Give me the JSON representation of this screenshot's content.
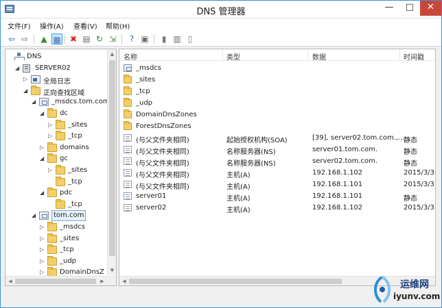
{
  "window": {
    "title": "DNS 管理器",
    "min": "—",
    "max": "□",
    "close": "✕"
  },
  "menu": [
    {
      "label": "文件(F)"
    },
    {
      "label": "操作(A)"
    },
    {
      "label": "查看(V)"
    },
    {
      "label": "帮助(H)"
    }
  ],
  "toolbar": [
    {
      "icon": "back-arrow-icon",
      "glyph": "⇦",
      "color": "#1a62b5"
    },
    {
      "icon": "forward-arrow-icon",
      "glyph": "⇨",
      "color": "#6f6f6f"
    },
    {
      "icon": "up-folder-icon",
      "glyph": "▲",
      "color": "#3b8e2f"
    },
    {
      "icon": "show-hide-tree-icon",
      "glyph": "▦",
      "color": "#4570a8"
    },
    {
      "icon": "delete-icon",
      "glyph": "✖",
      "color": "#d1281f"
    },
    {
      "icon": "properties-icon",
      "glyph": "▤",
      "color": "#6a6a6a"
    },
    {
      "icon": "refresh-icon",
      "glyph": "↻",
      "color": "#2f8a3a"
    },
    {
      "icon": "export-icon",
      "glyph": "⇲",
      "color": "#3b8e2f"
    },
    {
      "icon": "help-icon",
      "glyph": "?",
      "color": "#2f5fb0"
    },
    {
      "icon": "action-pane-icon",
      "glyph": "▣",
      "color": "#6a6a6a"
    },
    {
      "icon": "server-icon",
      "glyph": "▮",
      "color": "#7a7a7a"
    },
    {
      "icon": "list-icon",
      "glyph": "▥",
      "color": "#6a6a6a"
    },
    {
      "icon": "detail-icon",
      "glyph": "▯",
      "color": "#7a7a7a"
    }
  ],
  "tree": [
    {
      "label": "DNS",
      "icon": "dns-root",
      "arrow": "",
      "depth": 0
    },
    {
      "label": "SERVER02",
      "icon": "server",
      "arrow": "◢",
      "depth": 1
    },
    {
      "label": "全局日志",
      "icon": "log",
      "arrow": "▷",
      "depth": 2
    },
    {
      "label": "正向查找区域",
      "icon": "folder",
      "arrow": "◢",
      "depth": 2
    },
    {
      "label": "_msdcs.tom.com",
      "icon": "zone",
      "arrow": "◢",
      "depth": 3
    },
    {
      "label": "dc",
      "icon": "folder",
      "arrow": "◢",
      "depth": 4
    },
    {
      "label": "_sites",
      "icon": "folder",
      "arrow": "▷",
      "depth": 5
    },
    {
      "label": "_tcp",
      "icon": "folder",
      "arrow": "▷",
      "depth": 5
    },
    {
      "label": "domains",
      "icon": "folder",
      "arrow": "▷",
      "depth": 4
    },
    {
      "label": "gc",
      "icon": "folder",
      "arrow": "◢",
      "depth": 4
    },
    {
      "label": "_sites",
      "icon": "folder",
      "arrow": "▷",
      "depth": 5
    },
    {
      "label": "_tcp",
      "icon": "folder",
      "arrow": "",
      "depth": 5
    },
    {
      "label": "pdc",
      "icon": "folder",
      "arrow": "◢",
      "depth": 4
    },
    {
      "label": "_tcp",
      "icon": "folder",
      "arrow": "",
      "depth": 5
    },
    {
      "label": "tom.com",
      "icon": "zone",
      "arrow": "◢",
      "depth": 3,
      "selected": true
    },
    {
      "label": "_msdcs",
      "icon": "folder",
      "arrow": "▷",
      "depth": 4
    },
    {
      "label": "_sites",
      "icon": "folder",
      "arrow": "▷",
      "depth": 4
    },
    {
      "label": "_tcp",
      "icon": "folder",
      "arrow": "▷",
      "depth": 4
    },
    {
      "label": "_udp",
      "icon": "folder",
      "arrow": "▷",
      "depth": 4
    },
    {
      "label": "DomainDnsZ",
      "icon": "folder",
      "arrow": "▷",
      "depth": 4
    }
  ],
  "list": {
    "columns": [
      "名称",
      "类型",
      "数据",
      "时间戳"
    ],
    "rows": [
      {
        "icon": "zone",
        "name": "_msdcs",
        "type": "",
        "data": "",
        "time": ""
      },
      {
        "icon": "folder",
        "name": "_sites",
        "type": "",
        "data": "",
        "time": ""
      },
      {
        "icon": "folder",
        "name": "_tcp",
        "type": "",
        "data": "",
        "time": ""
      },
      {
        "icon": "folder",
        "name": "_udp",
        "type": "",
        "data": "",
        "time": ""
      },
      {
        "icon": "folder",
        "name": "DomainDnsZones",
        "type": "",
        "data": "",
        "time": ""
      },
      {
        "icon": "folder",
        "name": "ForestDnsZones",
        "type": "",
        "data": "",
        "time": ""
      },
      {
        "icon": "doc",
        "name": "(与父文件夹相同)",
        "type": "起始授权机构(SOA)",
        "data": "[39], server02.tom.com.,...",
        "time": "静态"
      },
      {
        "icon": "doc",
        "name": "(与父文件夹相同)",
        "type": "名称服务器(NS)",
        "data": "server01.tom.com.",
        "time": "静态"
      },
      {
        "icon": "doc",
        "name": "(与父文件夹相同)",
        "type": "名称服务器(NS)",
        "data": "server02.tom.com.",
        "time": "静态"
      },
      {
        "icon": "doc",
        "name": "(与父文件夹相同)",
        "type": "主机(A)",
        "data": "192.168.1.102",
        "time": "2015/3/3"
      },
      {
        "icon": "doc",
        "name": "(与父文件夹相同)",
        "type": "主机(A)",
        "data": "192.168.1.101",
        "time": "2015/3/3"
      },
      {
        "icon": "doc",
        "name": "server01",
        "type": "主机(A)",
        "data": "192.168.1.101",
        "time": "静态"
      },
      {
        "icon": "doc",
        "name": "server02",
        "type": "主机(A)",
        "data": "192.168.1.102",
        "time": "2015/3/3"
      }
    ]
  },
  "watermark": {
    "top": "运维网",
    "bottom": "iyunv.com"
  }
}
